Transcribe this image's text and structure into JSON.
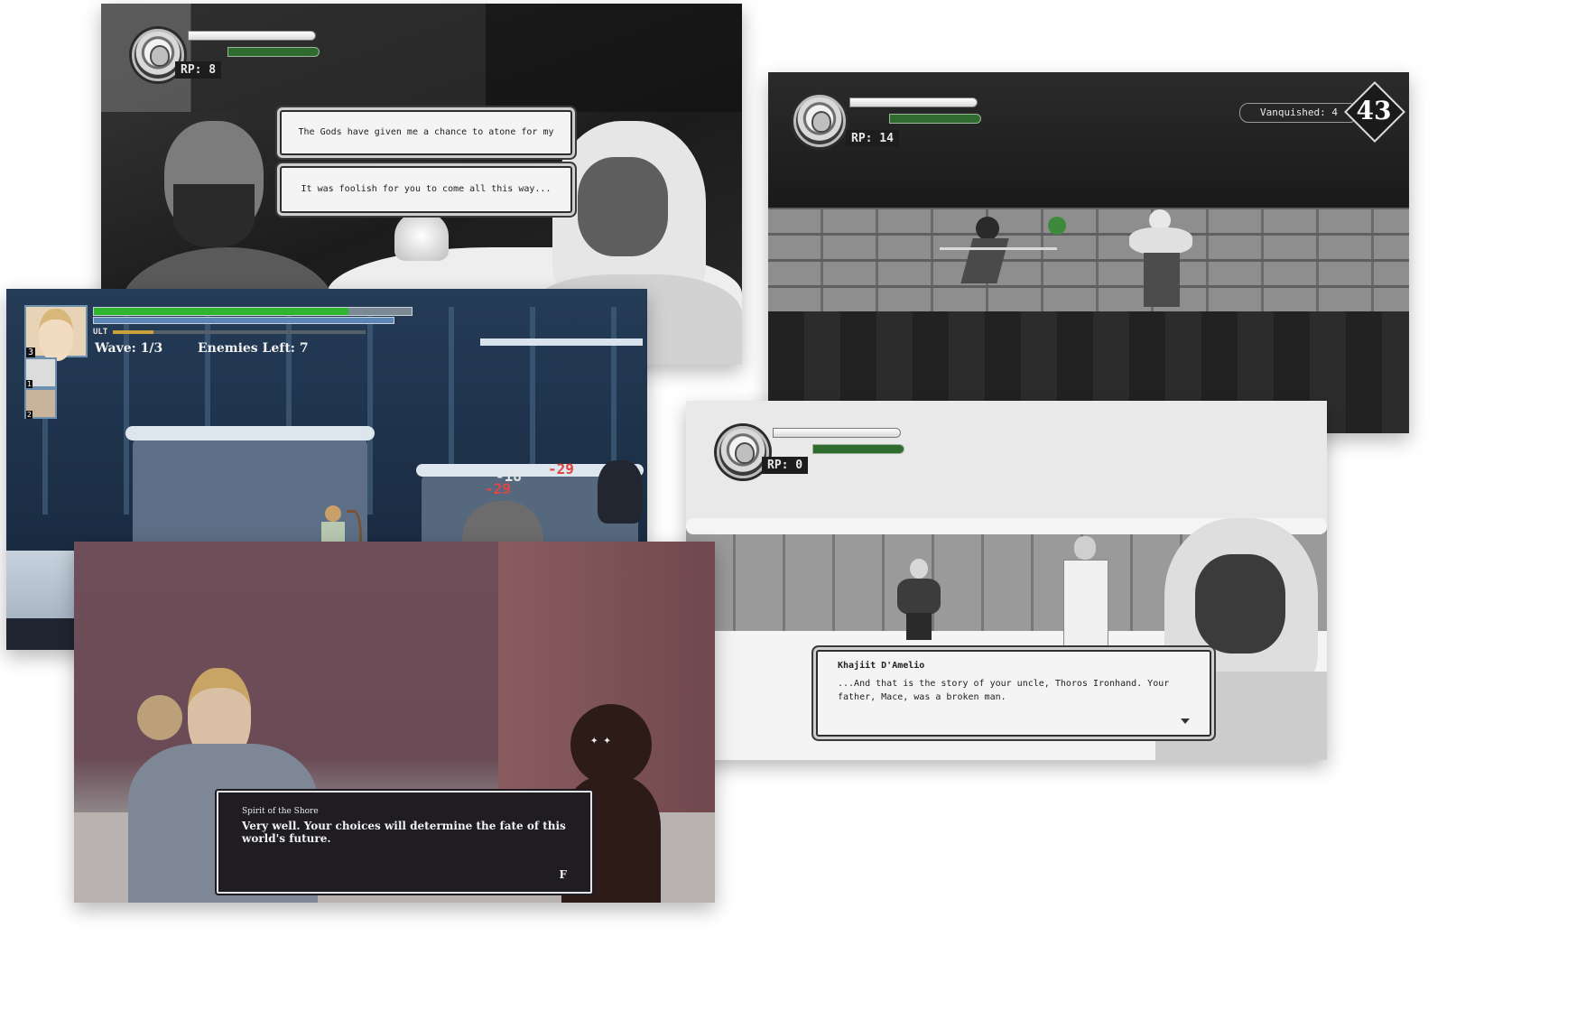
{
  "screens": {
    "campfire": {
      "rp_text": "RP: 8",
      "dialogue_1": "The Gods have given me a chance to atone for my sins...",
      "dialogue_2": "It was foolish for you to come all this way..."
    },
    "wall_fight": {
      "rp_text": "RP: 14",
      "vanquished_label": "Vanquished: 4",
      "counter": "43"
    },
    "snow_battle": {
      "portrait_main_level": "3",
      "portrait_2_level": "1",
      "portrait_3_level": "2",
      "ult_label": "ULT",
      "wave_text": "Wave: 1/3",
      "enemies_left_text": "Enemies Left: 7",
      "damage_1": "-18",
      "damage_2": "-29",
      "damage_3": "-29",
      "health_fraction": 0.8,
      "ult_fraction": 0.16
    },
    "snow_story": {
      "rp_text": "RP: 0",
      "speaker": "Khajiit D'Amelio",
      "dialogue": "...And that is the story of your uncle, Thoros Ironhand. Your father, Mace, was a broken man."
    },
    "spirit": {
      "speaker": "Spirit of the Shore",
      "dialogue": "Very well. Your choices will determine the fate of this world's future.",
      "key_hint": "F"
    }
  },
  "colors": {
    "health_green": "#2fb52f",
    "mana_blue": "#5b86b5",
    "ult_gold": "#c9a23a",
    "damage_red": "#e04545",
    "night_blue": "#1d3047",
    "dusk_purple": "#6b4a55"
  },
  "icons": [
    "emblem-icon",
    "chevron-down-icon",
    "diamond-counter-icon"
  ]
}
